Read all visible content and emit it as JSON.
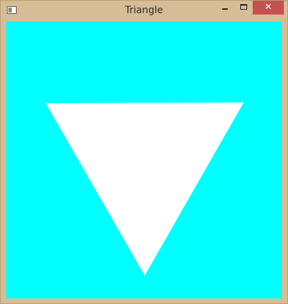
{
  "window": {
    "title": "Triangle",
    "icons": {
      "app": "app-window-icon",
      "minimize": "minimize-icon",
      "maximize": "maximize-icon",
      "close": "close-icon"
    },
    "close_glyph": "✕"
  },
  "canvas": {
    "background_color": "#00ffff",
    "shape": "inverted-triangle",
    "shape_color": "#ffffff"
  },
  "colors": {
    "frame": "#d6bd95",
    "close_button": "#c75050"
  }
}
